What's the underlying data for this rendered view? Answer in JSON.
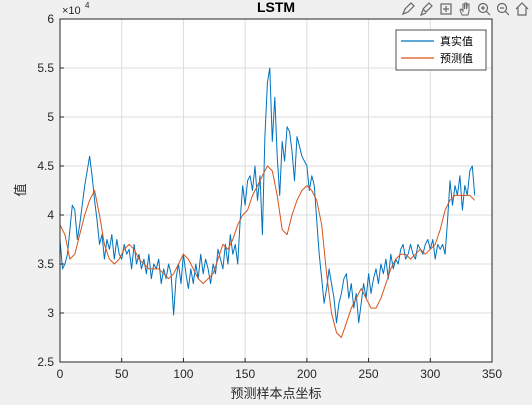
{
  "figure": {
    "background": "#f0f0f0",
    "axes_background": "#ffffff",
    "grid_color": "#dcdcdc",
    "axis_color": "#262626"
  },
  "toolbar": {
    "icons": [
      "edit-plot-icon",
      "brush-icon",
      "data-cursor-icon",
      "pan-hand-icon",
      "zoom-in-icon",
      "zoom-out-icon",
      "home-icon"
    ]
  },
  "chart_data": {
    "type": "line",
    "title": "LSTM",
    "xlabel": "预测样本点坐标",
    "ylabel": "值",
    "y_exponent_label": "×10",
    "y_exponent_power": "4",
    "xlim": [
      0,
      350
    ],
    "ylim": [
      2.5,
      6
    ],
    "x_ticks": [
      "0",
      "50",
      "100",
      "150",
      "200",
      "250",
      "300",
      "350"
    ],
    "y_ticks": [
      "2.5",
      "3",
      "3.5",
      "4",
      "4.5",
      "5",
      "5.5",
      "6"
    ],
    "grid": true,
    "legend_position": "top-right",
    "series": [
      {
        "name": "真实值",
        "color": "#0072bd",
        "x": [
          0,
          2,
          4,
          6,
          8,
          10,
          12,
          14,
          16,
          18,
          20,
          22,
          24,
          26,
          28,
          30,
          32,
          34,
          36,
          38,
          40,
          42,
          44,
          46,
          48,
          50,
          52,
          54,
          56,
          58,
          60,
          62,
          64,
          66,
          68,
          70,
          72,
          74,
          76,
          78,
          80,
          82,
          84,
          86,
          88,
          90,
          92,
          94,
          96,
          98,
          100,
          102,
          104,
          106,
          108,
          110,
          112,
          114,
          116,
          118,
          120,
          122,
          124,
          126,
          128,
          130,
          132,
          134,
          136,
          138,
          140,
          142,
          144,
          146,
          148,
          150,
          152,
          154,
          156,
          158,
          160,
          162,
          164,
          166,
          168,
          170,
          172,
          174,
          176,
          178,
          180,
          182,
          184,
          186,
          188,
          190,
          192,
          194,
          196,
          198,
          200,
          202,
          204,
          206,
          208,
          210,
          212,
          214,
          216,
          218,
          220,
          222,
          224,
          226,
          228,
          230,
          232,
          234,
          236,
          238,
          240,
          242,
          244,
          246,
          248,
          250,
          252,
          254,
          256,
          258,
          260,
          262,
          264,
          266,
          268,
          270,
          272,
          274,
          276,
          278,
          280,
          282,
          284,
          286,
          288,
          290,
          292,
          294,
          296,
          298,
          300,
          302,
          304,
          306,
          308,
          310,
          312,
          314,
          316,
          318,
          320,
          322,
          324,
          326,
          328,
          330,
          332,
          334,
          336
        ],
        "values": [
          3.75,
          3.45,
          3.5,
          3.6,
          3.85,
          4.1,
          4.05,
          3.75,
          3.9,
          4.1,
          4.3,
          4.45,
          4.6,
          4.4,
          4.15,
          3.95,
          3.7,
          3.8,
          3.55,
          3.75,
          3.65,
          3.8,
          3.55,
          3.75,
          3.6,
          3.55,
          3.7,
          3.6,
          3.65,
          3.45,
          3.7,
          3.5,
          3.6,
          3.45,
          3.55,
          3.4,
          3.6,
          3.35,
          3.5,
          3.45,
          3.55,
          3.3,
          3.45,
          3.35,
          3.5,
          3.4,
          2.98,
          3.35,
          3.5,
          3.3,
          3.6,
          3.4,
          3.25,
          3.45,
          3.3,
          3.5,
          3.35,
          3.6,
          3.4,
          3.55,
          3.45,
          3.3,
          3.5,
          3.4,
          3.65,
          3.55,
          3.45,
          3.7,
          3.5,
          3.8,
          3.6,
          3.7,
          3.5,
          3.95,
          4.3,
          4.1,
          4.35,
          4.4,
          4.25,
          4.5,
          4.15,
          4.4,
          3.8,
          4.8,
          5.35,
          5.5,
          4.75,
          5.2,
          4.6,
          4.2,
          4.75,
          4.55,
          4.9,
          4.85,
          4.65,
          4.35,
          4.8,
          4.7,
          4.6,
          4.55,
          4.5,
          4.25,
          4.4,
          4.3,
          3.95,
          3.6,
          3.35,
          3.1,
          3.25,
          3.45,
          3.3,
          3.15,
          2.9,
          3.1,
          3.2,
          3.35,
          3.4,
          3.15,
          3.3,
          3.05,
          3.2,
          2.9,
          3.1,
          3.3,
          3.15,
          3.4,
          3.2,
          3.35,
          3.45,
          3.3,
          3.5,
          3.4,
          3.55,
          3.35,
          3.6,
          3.45,
          3.55,
          3.5,
          3.65,
          3.7,
          3.55,
          3.6,
          3.7,
          3.6,
          3.55,
          3.7,
          3.65,
          3.6,
          3.7,
          3.75,
          3.65,
          3.75,
          3.55,
          3.7,
          3.65,
          3.7,
          3.6,
          3.95,
          4.35,
          4.1,
          4.3,
          4.2,
          4.4,
          4.05,
          4.3,
          4.2,
          4.45,
          4.5,
          4.2
        ]
      },
      {
        "name": "预测值",
        "color": "#d95319",
        "x": [
          0,
          4,
          8,
          12,
          16,
          20,
          24,
          28,
          32,
          36,
          40,
          44,
          48,
          52,
          56,
          60,
          64,
          68,
          72,
          76,
          80,
          84,
          88,
          92,
          96,
          100,
          104,
          108,
          112,
          116,
          120,
          124,
          128,
          132,
          136,
          140,
          144,
          148,
          152,
          156,
          160,
          164,
          168,
          172,
          176,
          180,
          184,
          188,
          192,
          196,
          200,
          204,
          208,
          212,
          216,
          220,
          224,
          228,
          232,
          236,
          240,
          244,
          248,
          252,
          256,
          260,
          264,
          268,
          272,
          276,
          280,
          284,
          288,
          292,
          296,
          300,
          304,
          308,
          312,
          316,
          320,
          324,
          328,
          332,
          336
        ],
        "values": [
          3.9,
          3.8,
          3.55,
          3.6,
          3.8,
          4.0,
          4.15,
          4.25,
          4.0,
          3.7,
          3.55,
          3.5,
          3.55,
          3.65,
          3.7,
          3.65,
          3.55,
          3.5,
          3.45,
          3.45,
          3.45,
          3.4,
          3.35,
          3.4,
          3.5,
          3.6,
          3.55,
          3.45,
          3.35,
          3.3,
          3.35,
          3.4,
          3.55,
          3.7,
          3.65,
          3.75,
          3.9,
          4.0,
          4.05,
          4.2,
          4.3,
          4.4,
          4.5,
          4.45,
          4.2,
          3.85,
          3.8,
          4.0,
          4.15,
          4.25,
          4.3,
          4.25,
          4.15,
          3.9,
          3.4,
          3.0,
          2.8,
          2.75,
          2.9,
          3.05,
          3.15,
          3.25,
          3.15,
          3.05,
          3.05,
          3.15,
          3.3,
          3.45,
          3.55,
          3.6,
          3.6,
          3.55,
          3.6,
          3.65,
          3.6,
          3.65,
          3.7,
          3.85,
          4.05,
          4.15,
          4.2,
          4.2,
          4.2,
          4.2,
          4.15
        ]
      }
    ]
  }
}
